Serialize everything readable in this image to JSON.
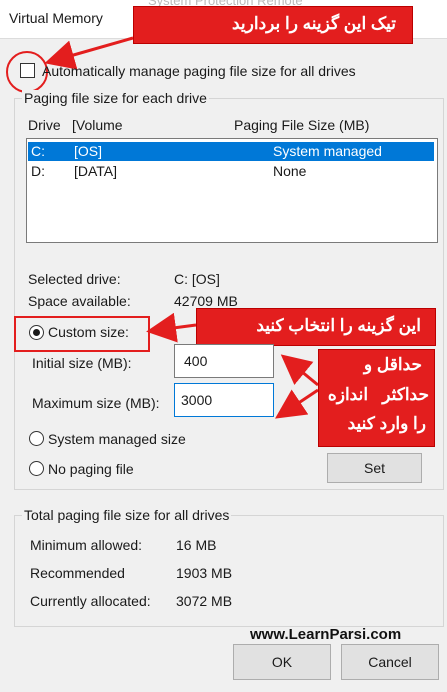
{
  "window": {
    "title": "Virtual Memory",
    "ghost_title": "System Protection  Remote"
  },
  "auto_manage": {
    "label": "Automatically manage paging file size for all drives",
    "checked": false
  },
  "paging_group": {
    "title": "Paging file size for each drive"
  },
  "table": {
    "headers": {
      "drive": "Drive",
      "volume": "[Volume",
      "size": "Paging File Size (MB)"
    },
    "rows": [
      {
        "drive": "C:",
        "volume": "[OS]",
        "size": "System managed",
        "selected": true
      },
      {
        "drive": "D:",
        "volume": "[DATA]",
        "size": "None",
        "selected": false
      }
    ]
  },
  "selected_drive": {
    "label": "Selected drive:",
    "value": "C:  [OS]"
  },
  "space_available": {
    "label": "Space available:",
    "value": "42709 MB"
  },
  "custom_size": {
    "label": "Custom size:",
    "checked": true
  },
  "initial_size": {
    "label": "Initial size (MB):",
    "value": "400"
  },
  "maximum_size": {
    "label": "Maximum size (MB):",
    "value": "3000"
  },
  "system_managed": {
    "label": "System managed size",
    "checked": false
  },
  "no_paging": {
    "label": "No paging file",
    "checked": false
  },
  "set_button": {
    "label": "Set"
  },
  "total_group": {
    "title": "Total paging file size for all drives",
    "minimum": {
      "label": "Minimum allowed:",
      "value": "16 MB"
    },
    "recommended": {
      "label": "Recommended",
      "value": "1903 MB"
    },
    "current": {
      "label": "Currently allocated:",
      "value": "3072 MB"
    }
  },
  "ok_button": {
    "label": "OK"
  },
  "cancel_button": {
    "label": "Cancel"
  },
  "annotations": {
    "uncheck": "تیک این گزینه را بردارید",
    "choose": "این گزینه را انتخاب کنید",
    "minmax_line1": "حداقل و",
    "minmax_line2": "حداکثر   اندازه",
    "minmax_line3": "را وارد کنید",
    "watermark": "www.LearnParsi.com"
  },
  "colors": {
    "accent": "#0078d7",
    "annotation_red": "#e31e1e",
    "window_bg": "#f0f0f0"
  }
}
